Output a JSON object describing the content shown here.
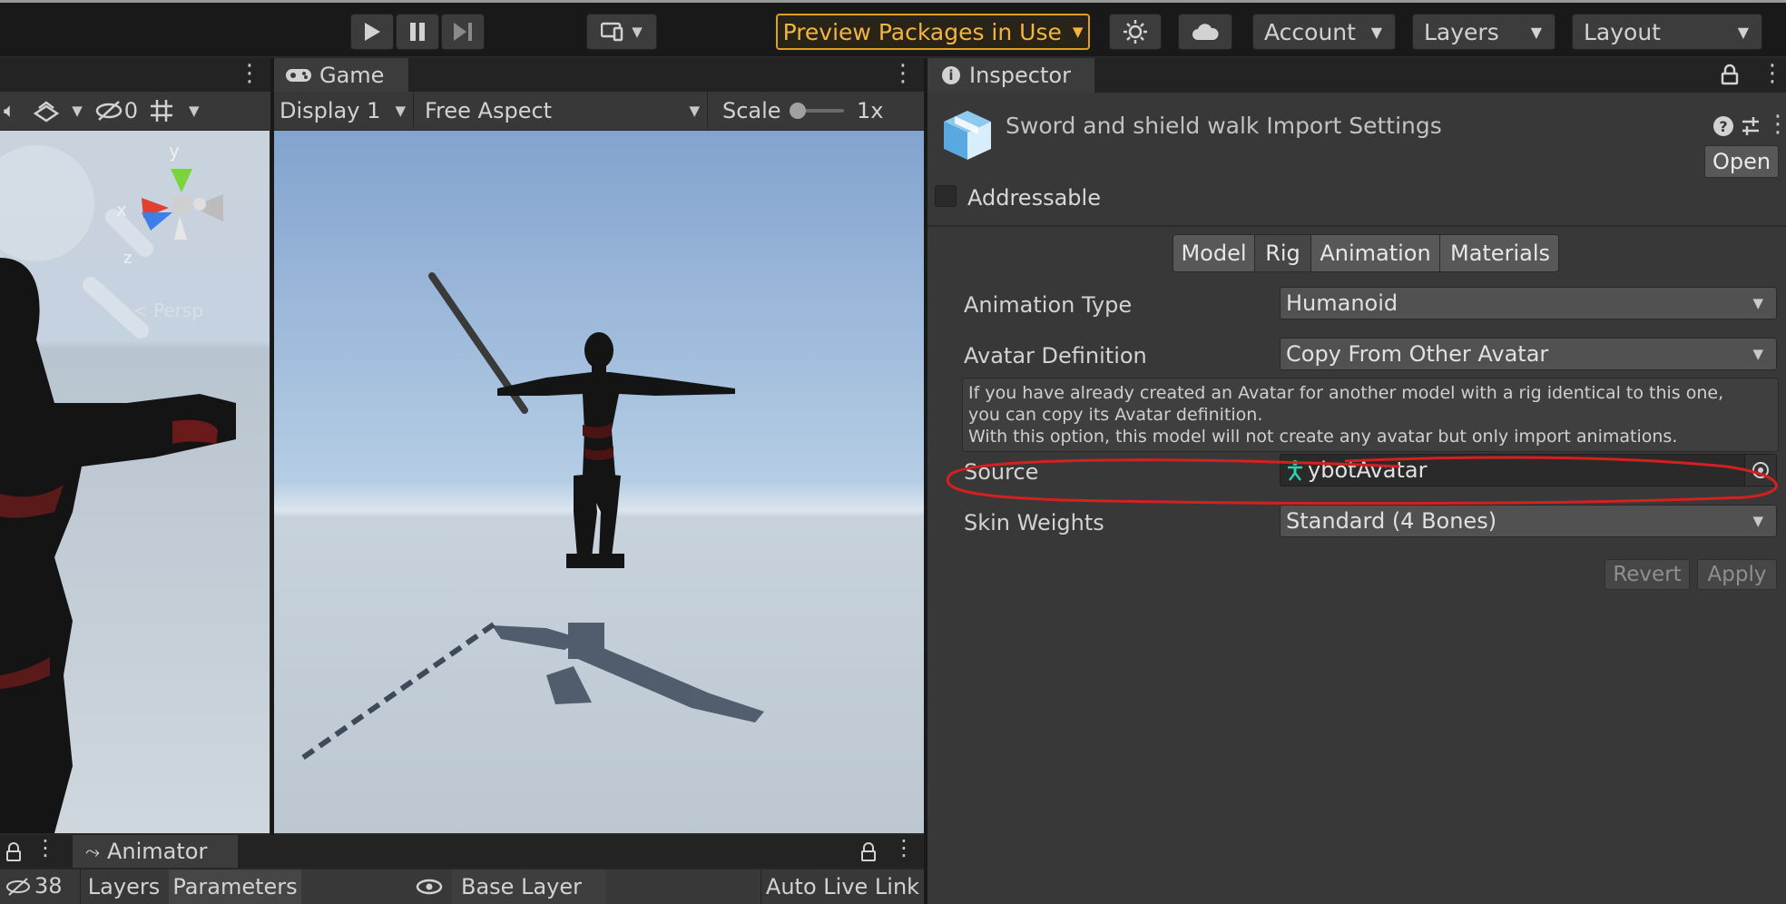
{
  "toolbar": {
    "preview_label": "Preview Packages in Use",
    "account_label": "Account",
    "layers_label": "Layers",
    "layout_label": "Layout"
  },
  "scene": {
    "hidden_count": "0",
    "gizmo_y": "y",
    "gizmo_x": "x",
    "gizmo_z": "z",
    "persp_label": "< Persp"
  },
  "game": {
    "tab_label": "Game",
    "display_label": "Display 1",
    "aspect_label": "Free Aspect",
    "scale_label": "Scale",
    "scale_value": "1x"
  },
  "inspector": {
    "tab_label": "Inspector",
    "title": "Sword and shield walk Import Settings",
    "open_label": "Open",
    "addressable_label": "Addressable",
    "tabs": [
      "Model",
      "Rig",
      "Animation",
      "Materials"
    ],
    "active_tab": "Rig",
    "animation_type_label": "Animation Type",
    "animation_type_value": "Humanoid",
    "avatar_definition_label": "Avatar Definition",
    "avatar_definition_value": "Copy From Other Avatar",
    "help_line1": "If you have already created an Avatar for another model with a rig identical to this one,",
    "help_line2": "you can copy its Avatar definition.",
    "help_line3": "With this option, this model will not create any avatar but only import animations.",
    "source_label": "Source",
    "source_value": "ybotAvatar",
    "skin_weights_label": "Skin Weights",
    "skin_weights_value": "Standard (4 Bones)",
    "revert_label": "Revert",
    "apply_label": "Apply"
  },
  "bottom": {
    "animator_label": "Animator",
    "hidden_count": "38",
    "layers_label": "Layers",
    "parameters_label": "Parameters",
    "base_layer_label": "Base Layer",
    "auto_live_link_label": "Auto Live Link"
  },
  "colors": {
    "annotation": "#d42020",
    "preview_accent": "#f1b540"
  }
}
